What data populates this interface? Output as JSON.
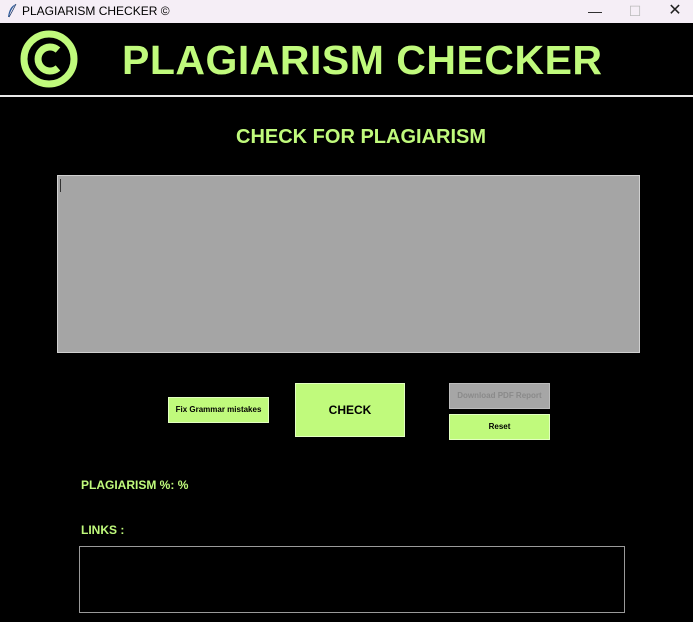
{
  "window": {
    "title": "PLAGIARISM CHECKER ©",
    "minimize": "—",
    "maximize": "☐",
    "close": "✕"
  },
  "header": {
    "logo_icon": "copyright-icon",
    "title": "PLAGIARISM CHECKER"
  },
  "main": {
    "section_title": "CHECK FOR PLAGIARISM",
    "input_text": ""
  },
  "buttons": {
    "grammar": "Fix Grammar mistakes",
    "check": "CHECK",
    "download": "Download PDF Report",
    "reset": "Reset"
  },
  "results": {
    "plagiarism_label": "PLAGIARISM %:",
    "plagiarism_value": "%",
    "links_label": "LINKS :",
    "links_text": ""
  },
  "colors": {
    "accent": "#c0fa7c",
    "background": "#000000",
    "textarea": "#a5a5a5",
    "disabled": "#a6a6a6"
  }
}
